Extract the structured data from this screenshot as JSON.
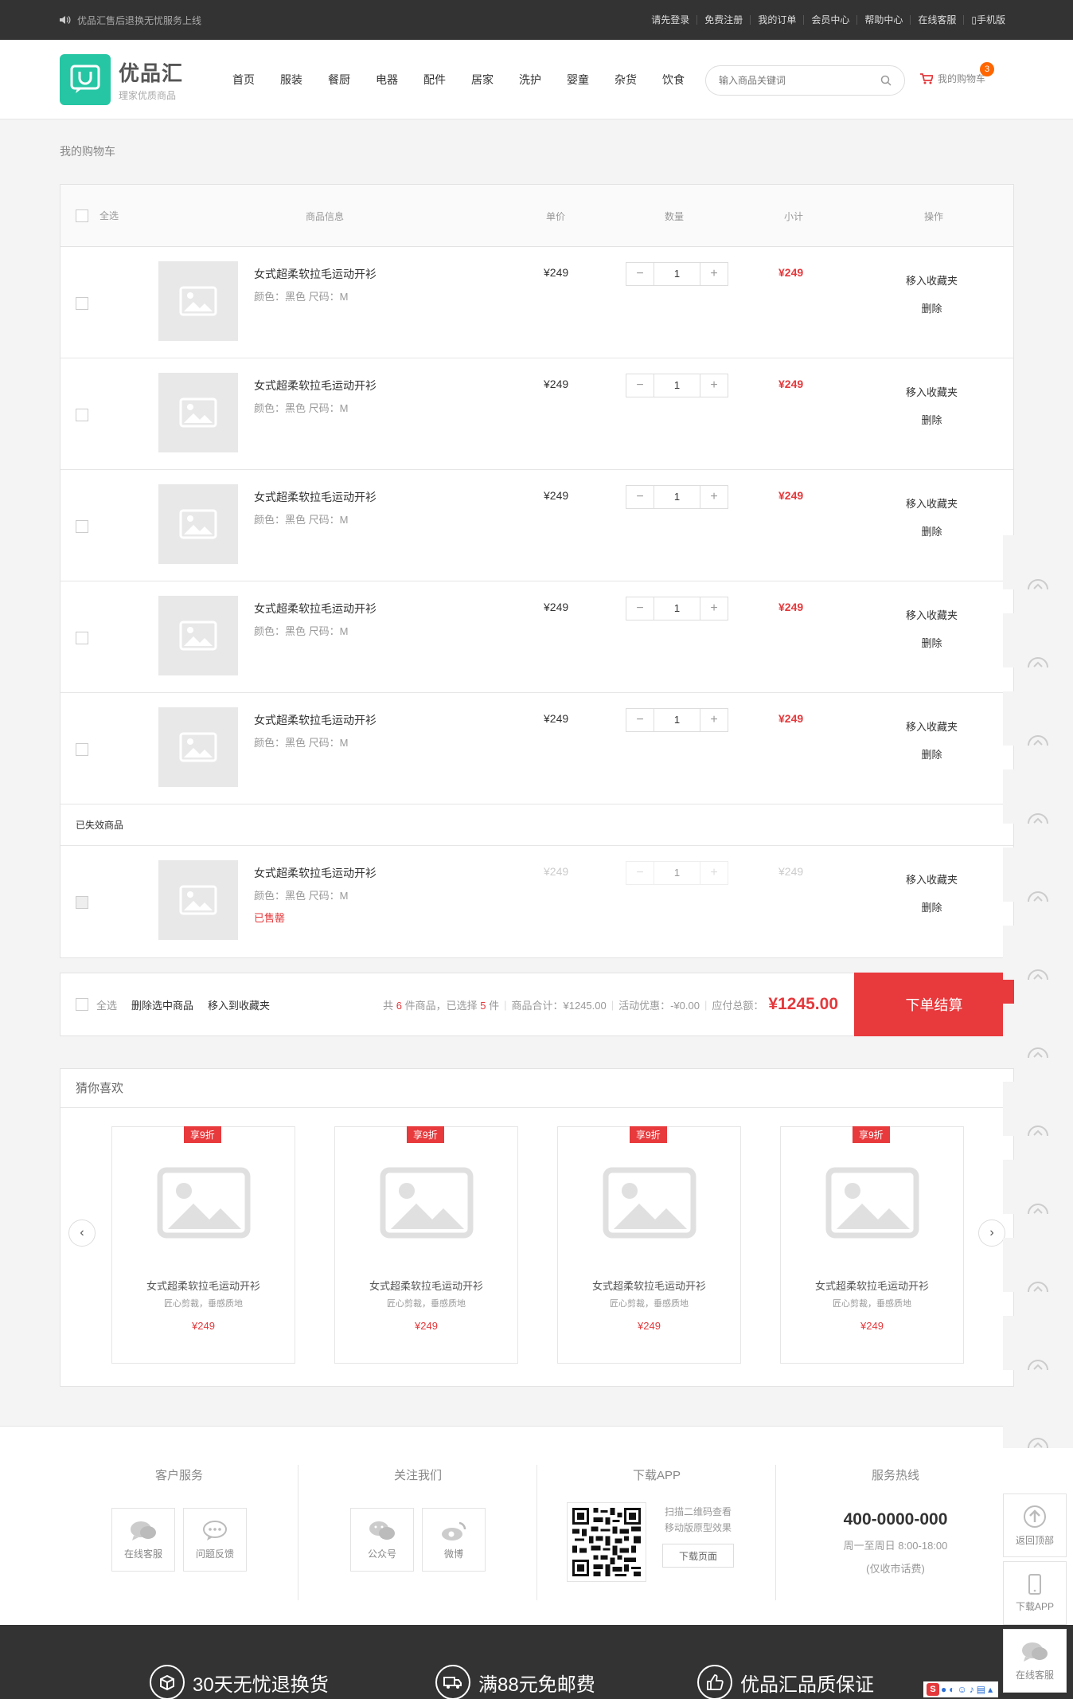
{
  "topbar": {
    "notice": "优品汇售后退换无忧服务上线",
    "links": [
      "请先登录",
      "免费注册",
      "我的订单",
      "会员中心",
      "帮助中心",
      "在线客服",
      "手机版"
    ]
  },
  "header": {
    "logo_name": "优品汇",
    "logo_slogan": "理家优质商品",
    "nav": [
      "首页",
      "服装",
      "餐厨",
      "电器",
      "配件",
      "居家",
      "洗护",
      "婴童",
      "杂货",
      "饮食"
    ],
    "search_placeholder": "输入商品关键词",
    "cart_label": "我的购物车",
    "cart_count": "3"
  },
  "breadcrumb": "我的购物车",
  "cart": {
    "columns": {
      "select_all": "全选",
      "info": "商品信息",
      "price": "单价",
      "qty": "数量",
      "subtotal": "小计",
      "ops": "操作"
    },
    "items": [
      {
        "name": "女式超柔软拉毛运动开衫",
        "spec": "颜色：黑色 尺码：M",
        "price": "¥249",
        "qty": "1",
        "subtotal": "¥249",
        "op_fav": "移入收藏夹",
        "op_del": "删除"
      },
      {
        "name": "女式超柔软拉毛运动开衫",
        "spec": "颜色：黑色 尺码：M",
        "price": "¥249",
        "qty": "1",
        "subtotal": "¥249",
        "op_fav": "移入收藏夹",
        "op_del": "删除"
      },
      {
        "name": "女式超柔软拉毛运动开衫",
        "spec": "颜色：黑色 尺码：M",
        "price": "¥249",
        "qty": "1",
        "subtotal": "¥249",
        "op_fav": "移入收藏夹",
        "op_del": "删除"
      },
      {
        "name": "女式超柔软拉毛运动开衫",
        "spec": "颜色：黑色 尺码：M",
        "price": "¥249",
        "qty": "1",
        "subtotal": "¥249",
        "op_fav": "移入收藏夹",
        "op_del": "删除"
      },
      {
        "name": "女式超柔软拉毛运动开衫",
        "spec": "颜色：黑色 尺码：M",
        "price": "¥249",
        "qty": "1",
        "subtotal": "¥249",
        "op_fav": "移入收藏夹",
        "op_del": "删除"
      }
    ],
    "invalid_title": "已失效商品",
    "invalid_item": {
      "name": "女式超柔软拉毛运动开衫",
      "spec": "颜色：黑色 尺码：M",
      "status": "已售罄",
      "price": "¥249",
      "qty": "1",
      "subtotal": "¥249",
      "op_fav": "移入收藏夹",
      "op_del": "删除"
    }
  },
  "checkout": {
    "select_all": "全选",
    "delete_selected": "删除选中商品",
    "move_fav": "移入到收藏夹",
    "summary_prefix": "共",
    "total_count": "6",
    "summary_mid": "件商品，已选择",
    "selected_count": "5",
    "summary_suffix": "件",
    "goods_total": "商品合计：¥1245.00",
    "discount": "活动优惠：-¥0.00",
    "payable_label": "应付总额：",
    "payable": "¥1245.00",
    "submit": "下单结算"
  },
  "recommend": {
    "title": "猜你喜欢",
    "items": [
      {
        "tag": "享9折",
        "name": "女式超柔软拉毛运动开衫",
        "desc": "匠心剪裁，垂感质地",
        "price": "¥249"
      },
      {
        "tag": "享9折",
        "name": "女式超柔软拉毛运动开衫",
        "desc": "匠心剪裁，垂感质地",
        "price": "¥249"
      },
      {
        "tag": "享9折",
        "name": "女式超柔软拉毛运动开衫",
        "desc": "匠心剪裁，垂感质地",
        "price": "¥249"
      },
      {
        "tag": "享9折",
        "name": "女式超柔软拉毛运动开衫",
        "desc": "匠心剪裁，垂感质地",
        "price": "¥249"
      }
    ]
  },
  "footer": {
    "service_title": "客户服务",
    "service_online": "在线客服",
    "service_feedback": "问题反馈",
    "follow_title": "关注我们",
    "follow_wechat": "公众号",
    "follow_weibo": "微博",
    "app_title": "下载APP",
    "app_desc1": "扫描二维码查看",
    "app_desc2": "移动版原型效果",
    "app_download": "下载页面",
    "hotline_title": "服务热线",
    "hotline": "400-0000-000",
    "hotline_time": "周一至周日 8:00-18:00",
    "hotline_note": "(仅收市话费)"
  },
  "promise": [
    "30天无忧退换货",
    "满88元免邮费",
    "优品汇品质保证"
  ],
  "side_toolbar": {
    "back_top": "返回顶部",
    "download_app": "下载APP",
    "online_service": "在线客服"
  },
  "colors": {
    "accent": "#e8393c",
    "brand": "#26c6a4",
    "topbar": "#333333"
  }
}
